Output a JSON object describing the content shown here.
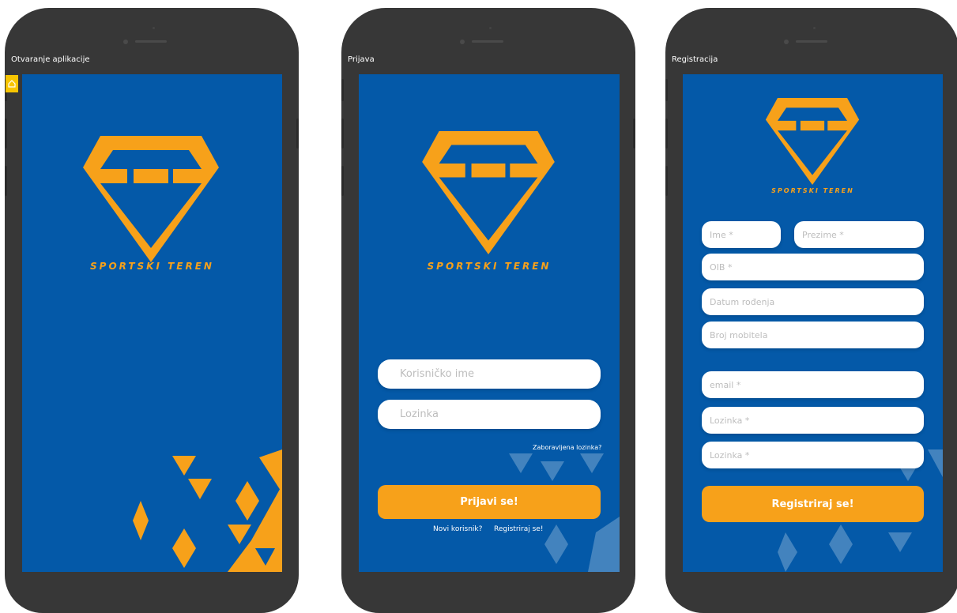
{
  "screens": {
    "opening": {
      "title": "Otvaranje aplikacije",
      "brand": "SPORTSKI TEREN"
    },
    "login": {
      "title": "Prijava",
      "brand": "SPORTSKI TEREN",
      "username_placeholder": "Korisničko ime",
      "password_placeholder": "Lozinka",
      "forgot_password": "Zaboravljena lozinka?",
      "login_button": "Prijavi se!",
      "new_user_text": "Novi korisnik?",
      "register_link": "Registriraj se!"
    },
    "register": {
      "title": "Registracija",
      "brand": "SPORTSKI TEREN",
      "first_name_placeholder": "Ime *",
      "last_name_placeholder": "Prezime *",
      "oib_placeholder": "OIB *",
      "birth_date_placeholder": "Datum rođenja",
      "phone_placeholder": "Broj mobitela",
      "email_placeholder": "email *",
      "password_placeholder": "Lozinka *",
      "password_confirm_placeholder": "Lozinka *",
      "register_button": "Registriraj se!"
    }
  },
  "colors": {
    "screen_bg": "#0459a8",
    "accent": "#f7a11a",
    "phone_frame": "#373737"
  },
  "icons": [
    "home-icon",
    "sportski-teren-logo"
  ]
}
